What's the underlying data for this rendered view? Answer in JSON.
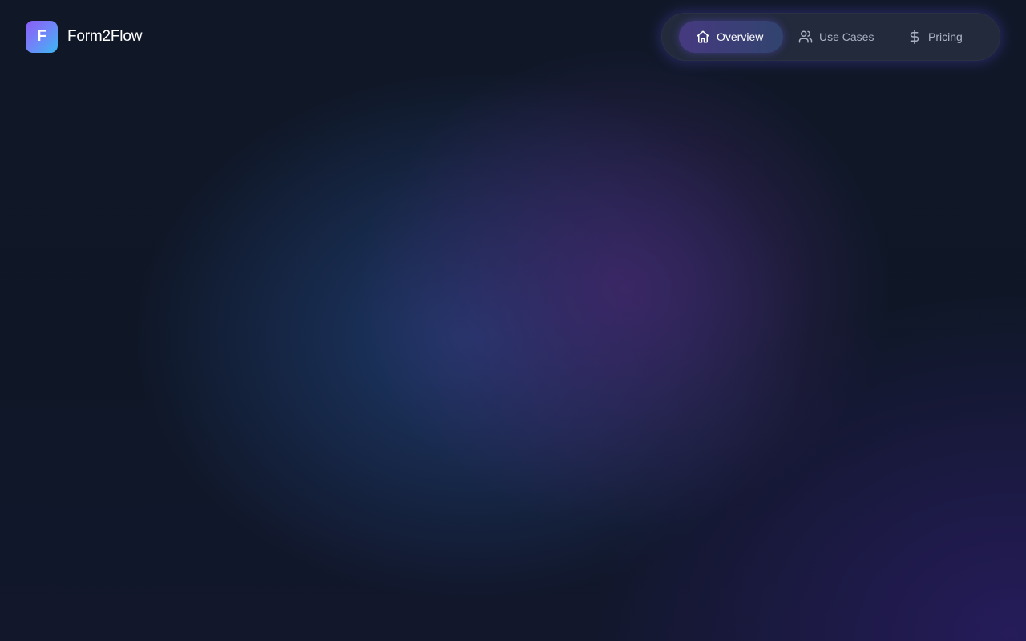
{
  "brand": {
    "logo_letter": "F",
    "name": "Form2Flow"
  },
  "nav": {
    "items": [
      {
        "label": "Overview",
        "icon": "home-icon",
        "active": true
      },
      {
        "label": "Use Cases",
        "icon": "users-icon",
        "active": false
      },
      {
        "label": "Pricing",
        "icon": "dollar-icon",
        "active": false
      }
    ]
  },
  "colors": {
    "background": "#0f1626",
    "accent_purple": "#8b5cf6",
    "accent_cyan": "#3ab8f2",
    "nav_pill": "#242c3e",
    "nav_text": "#aab2c3",
    "nav_text_active": "#ffffff"
  }
}
